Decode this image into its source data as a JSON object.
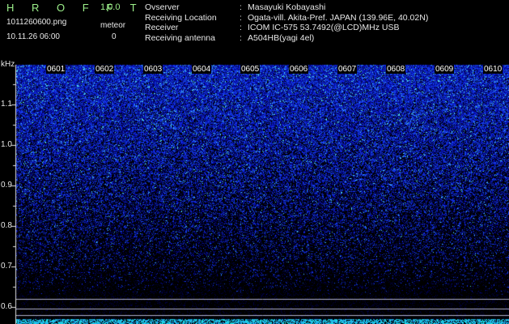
{
  "header": {
    "app_title": "H R O F F T",
    "version": "1.0.0",
    "filename": "1011260600.png",
    "datetime": "10.11.26 06:00",
    "meteor_label": "meteor",
    "meteor_count": "0"
  },
  "info": [
    {
      "key": "Ovserver",
      "sep": ":",
      "value": "Masayuki Kobayashi"
    },
    {
      "key": "Receiving Location",
      "sep": ":",
      "value": "Ogata-vill. Akita-Pref. JAPAN (139.96E, 40.02N)"
    },
    {
      "key": "Receiver",
      "sep": ":",
      "value": "ICOM IC-575 53.7492(@LCD)MHz USB"
    },
    {
      "key": "Receiving antenna",
      "sep": ":",
      "value": "A504HB(yagi 4el)"
    }
  ],
  "spectrogram": {
    "y_unit": "kHz",
    "y_ticks": [
      "1.1",
      "1.0",
      "0.9",
      "0.8",
      "0.7",
      "0.6"
    ],
    "time_labels": [
      "0601",
      "0602",
      "0603",
      "0604",
      "0605",
      "0606",
      "0607",
      "0608",
      "0609",
      "0610"
    ],
    "colors": {
      "text": "#e8e8e8",
      "title": "#9cf08a",
      "signal": "#1a2cff",
      "hot": "#4ee0e8"
    }
  }
}
